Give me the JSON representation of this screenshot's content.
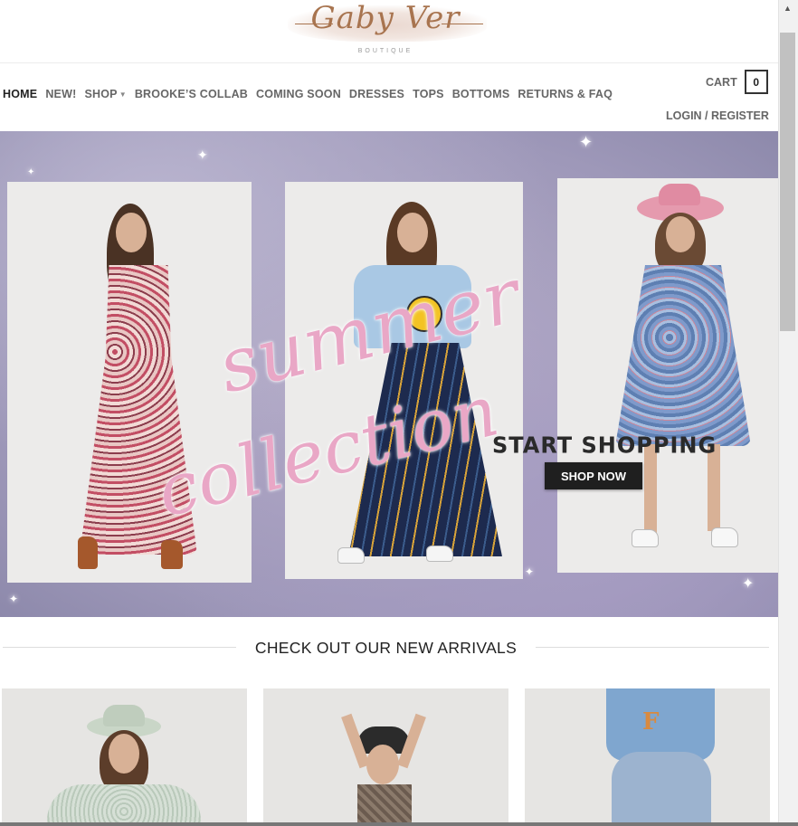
{
  "brand": {
    "name": "Gaby Ver",
    "tagline": "BOUTIQUE"
  },
  "nav": {
    "items": [
      {
        "label": "HOME",
        "active": true
      },
      {
        "label": "NEW!"
      },
      {
        "label": "SHOP",
        "has_dropdown": true
      },
      {
        "label": "BROOKE’S COLLAB"
      },
      {
        "label": "COMING SOON"
      },
      {
        "label": "DRESSES"
      },
      {
        "label": "TOPS"
      },
      {
        "label": "BOTTOMS"
      },
      {
        "label": "RETURNS & FAQ"
      }
    ],
    "chevron_icon": "chevron-down-icon"
  },
  "account": {
    "cart_label": "CART",
    "cart_count": "0",
    "login_label": "LOGIN / REGISTER"
  },
  "hero": {
    "script_line_1": "summer",
    "script_line_2": "collection",
    "cta_heading": "START SHOPPING",
    "cta_button": "SHOP NOW"
  },
  "arrivals": {
    "title": "CHECK OUT OUR NEW ARRIVALS"
  },
  "colors": {
    "accent_script": "#e9a7c6",
    "logo": "#a8744f",
    "button_bg": "#1f1f1f"
  }
}
